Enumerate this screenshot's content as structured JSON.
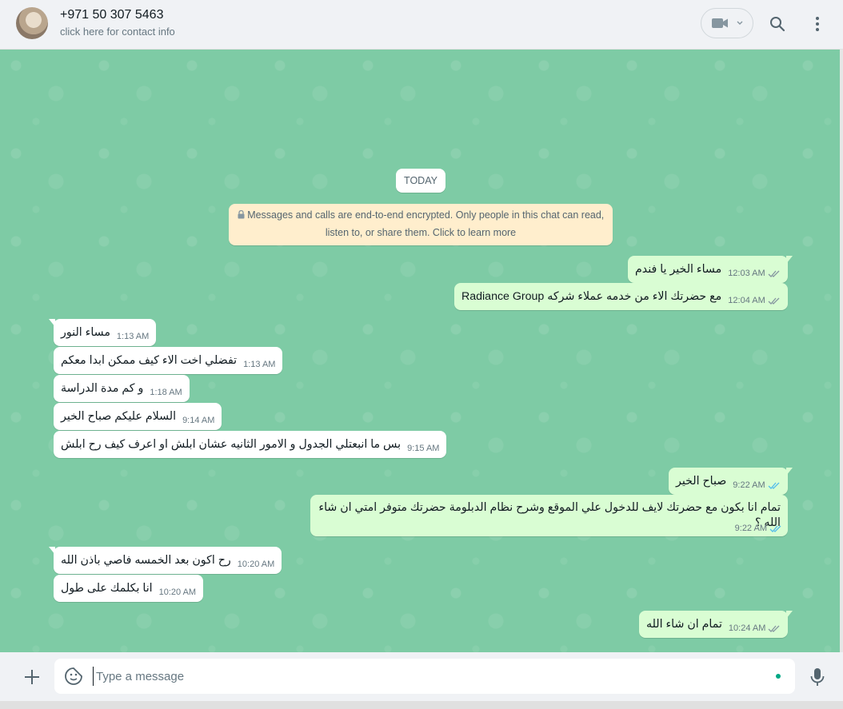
{
  "header": {
    "contact_name": "+971 50 307 5463",
    "contact_sub": "click here for contact info"
  },
  "chat": {
    "date_divider": "TODAY",
    "encryption_notice_line1": "Messages and calls are end-to-end encrypted. Only people in this chat can read,",
    "encryption_notice_line2": "listen to, or share them. Click to learn more",
    "messages": [
      {
        "dir": "out",
        "text": "مساء الخير يا فندم",
        "time": "12:03 AM"
      },
      {
        "dir": "out",
        "text": "مع حضرتك الاء من خدمه عملاء شركه Radiance Group",
        "time": "12:04 AM"
      },
      {
        "dir": "in",
        "text": "مساء النور",
        "time": "1:13 AM"
      },
      {
        "dir": "in",
        "text": "تفضلي اخت الاء كيف ممكن ابدا معكم",
        "time": "1:13 AM"
      },
      {
        "dir": "in",
        "text": "و كم مدة الدراسة",
        "time": "1:18 AM"
      },
      {
        "dir": "in",
        "text": "السلام عليكم صباح الخير",
        "time": "9:14 AM"
      },
      {
        "dir": "in",
        "text": "بس ما انبعتلي الجدول و الامور الثانيه عشان ابلش او اعرف كيف رح ابلش",
        "time": "9:15 AM"
      },
      {
        "dir": "out",
        "text": "صباح الخير",
        "time": "9:22 AM"
      },
      {
        "dir": "out",
        "text": "تمام انا بكون مع حضرتك لايف للدخول علي الموقع وشرح نظام الدبلومة حضرتك متوفر امتي ان شاء الله ؟",
        "time": "9:22 AM"
      },
      {
        "dir": "in",
        "text": "رح اكون بعد الخمسه فاصي باذن الله",
        "time": "10:20 AM"
      },
      {
        "dir": "in",
        "text": "انا بكلمك على طول",
        "time": "10:20 AM"
      },
      {
        "dir": "out",
        "text": "تمام ان شاء الله",
        "time": "10:24 AM"
      }
    ]
  },
  "composer": {
    "placeholder": "Type a message"
  },
  "colors": {
    "chat_bg": "#7ecba5",
    "outgoing_bubble": "#d9fdd3",
    "incoming_bubble": "#ffffff",
    "read_ticks": "#53bdeb",
    "delivered_ticks": "#8696a0"
  }
}
